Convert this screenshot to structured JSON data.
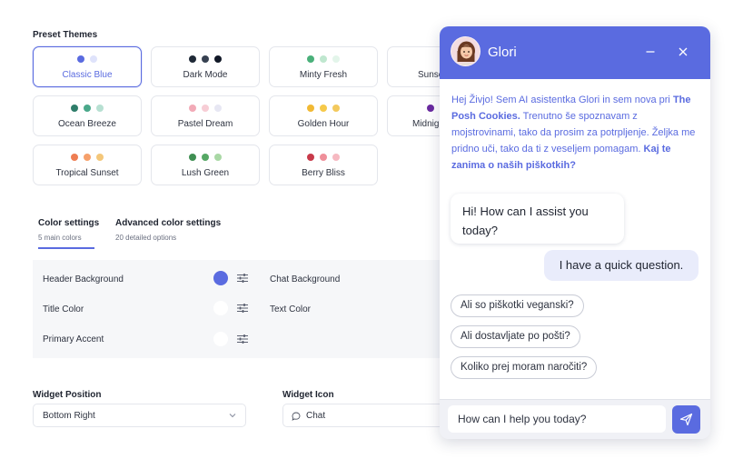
{
  "preset_themes": {
    "title": "Preset Themes",
    "themes": [
      {
        "name": "Classic Blue",
        "selected": true,
        "colors": [
          "#5a6be0",
          "#dfe3fb"
        ]
      },
      {
        "name": "Dark Mode",
        "selected": false,
        "colors": [
          "#1f2937",
          "#374151",
          "#111827"
        ]
      },
      {
        "name": "Minty Fresh",
        "selected": false,
        "colors": [
          "#4ab07a",
          "#bfe7cf",
          "#e3f5ea"
        ]
      },
      {
        "name": "Sunse",
        "selected": false,
        "colors": []
      },
      {
        "name": "Ocean Breeze",
        "selected": false,
        "colors": [
          "#2f7d6a",
          "#4aa88a",
          "#b7e0d2"
        ]
      },
      {
        "name": "Pastel Dream",
        "selected": false,
        "colors": [
          "#f2aab7",
          "#f7cdd5",
          "#e7e7f3"
        ]
      },
      {
        "name": "Golden Hour",
        "selected": false,
        "colors": [
          "#f1b934",
          "#f6c94a",
          "#f3c95d"
        ]
      },
      {
        "name": "Midnigh",
        "selected": false,
        "colors": [
          "#6a2aa0"
        ]
      },
      {
        "name": "Tropical Sunset",
        "selected": false,
        "colors": [
          "#ee7d52",
          "#f6a06b",
          "#f4c77a"
        ]
      },
      {
        "name": "Lush Green",
        "selected": false,
        "colors": [
          "#3f8f52",
          "#56a865",
          "#a9d8a5"
        ]
      },
      {
        "name": "Berry Bliss",
        "selected": false,
        "colors": [
          "#c83a4a",
          "#ef8f9a",
          "#f6b9c1"
        ]
      }
    ]
  },
  "tabs": [
    {
      "label": "Color settings",
      "sub": "5 main colors",
      "active": true
    },
    {
      "label": "Advanced color settings",
      "sub": "20 detailed options",
      "active": false
    }
  ],
  "color_settings": {
    "header_background": {
      "label": "Header Background",
      "color": "#5a6be0"
    },
    "title_color": {
      "label": "Title Color",
      "color": "#ffffff"
    },
    "primary_accent": {
      "label": "Primary Accent",
      "color": "#ffffff"
    },
    "chat_background": {
      "label": "Chat Background"
    },
    "text_color": {
      "label": "Text Color"
    }
  },
  "widget_position": {
    "label": "Widget Position",
    "value": "Bottom Right"
  },
  "widget_icon": {
    "label": "Widget Icon",
    "value": "Chat",
    "icon": "chat-bubble-icon"
  },
  "chat_widget": {
    "title": "Glori",
    "intro": {
      "part1": "Hej Živjo! Sem AI asistentka Glori in sem nova pri ",
      "brand": "The Posh Cookies.",
      "part2": " Trenutno še spoznavam z mojstrovinami, tako da prosim za potrpljenje. Željka me pridno uči, tako da ti z veseljem pomagam. ",
      "question": "Kaj te zanima o naših piškotkih?"
    },
    "bot_message": "Hi! How can I assist you today?",
    "user_message": "I have a quick question.",
    "suggestions": [
      "Ali so piškotki veganski?",
      "Ali dostavljate po pošti?",
      "Koliko prej moram naročiti?"
    ],
    "input_placeholder": "How can I help you today?",
    "accent_color": "#5a6be0"
  }
}
